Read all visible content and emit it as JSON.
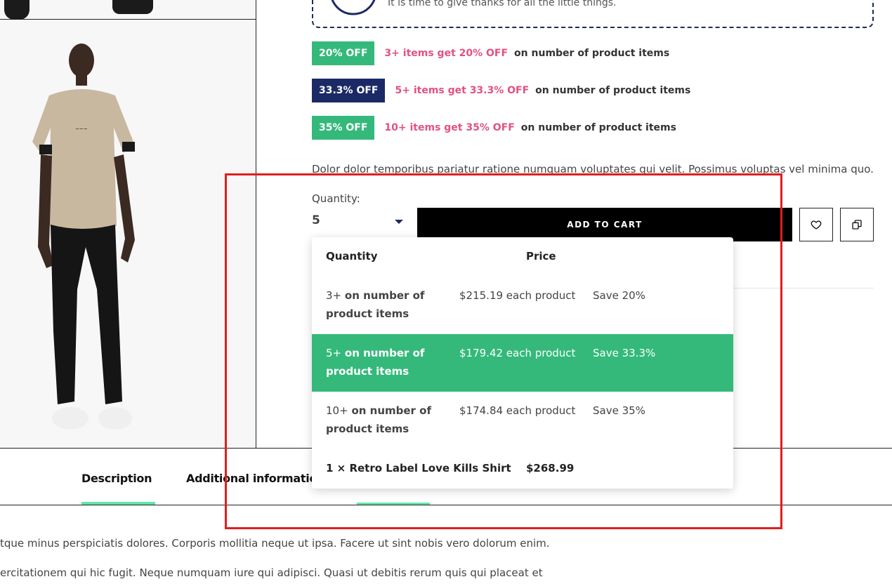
{
  "gift": {
    "text": "It is time to give thanks for all the little things."
  },
  "discounts": [
    {
      "badge": "20% OFF",
      "badge_color": "#34b97b",
      "highlight": "3+ items get 20% OFF",
      "suffix": "on number of product items"
    },
    {
      "badge": "33.3% OFF",
      "badge_color": "#1b2a66",
      "highlight": "5+ items get 33.3% OFF",
      "suffix": "on number of product items"
    },
    {
      "badge": "35% OFF",
      "badge_color": "#34b97b",
      "highlight": "10+ items get 35% OFF",
      "suffix": "on number of product items"
    }
  ],
  "description": "Dolor dolor temporibus pariatur ratione numquam voluptates qui velit. Possimus voluptas vel minima quo.",
  "quantity": {
    "label": "Quantity:",
    "value": "5"
  },
  "actions": {
    "add_to_cart": "ADD TO CART",
    "wishlist_icon": "heart-icon",
    "compare_icon": "compare-icon"
  },
  "dropdown": {
    "headers": {
      "quantity": "Quantity",
      "price": "Price"
    },
    "rows": [
      {
        "qty": "3+",
        "qty_text": "on number of product items",
        "price": "$215.19 each product",
        "save": "Save 20%",
        "active": false
      },
      {
        "qty": "5+",
        "qty_text": "on number of product items",
        "price": "$179.42 each product",
        "save": "Save 33.3%",
        "active": true
      },
      {
        "qty": "10+",
        "qty_text": "on number of product items",
        "price": "$174.84 each product",
        "save": "Save 35%",
        "active": false
      }
    ],
    "total": {
      "label": "1 × Retro Label Love Kills Shirt",
      "price": "$268.99"
    }
  },
  "tabs": [
    {
      "label": "Description",
      "active": true
    },
    {
      "label": "Additional informatio",
      "active": false
    }
  ],
  "paragraphs": [
    "tque minus perspiciatis dolores. Corporis mollitia neque ut ipsa. Facere ut sint nobis vero dolorum enim.",
    "ercitationem qui hic fugit. Neque numquam iure qui adipisci. Quasi ut debitis rerum quis qui placeat et"
  ],
  "colors": {
    "accent_green": "#34b97b",
    "navy": "#1b2a66",
    "pink": "#e2527f",
    "tab_underline": "#5ee6a4",
    "highlight_red": "#e01e1e"
  }
}
